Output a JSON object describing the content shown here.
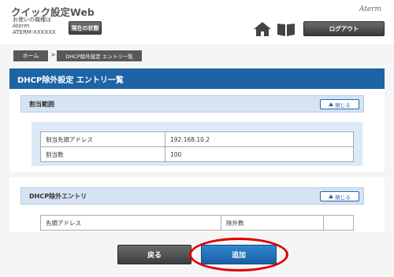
{
  "header": {
    "app_title": "クイック設定Web",
    "model_label": "お使いの機種は",
    "model_name": "Aterm",
    "model_id": "ATERM-XXXXXX",
    "status_button": "現在の状態",
    "brand": "Aterm",
    "logout_button": "ログアウト"
  },
  "breadcrumb": {
    "home": "ホーム",
    "separator": ">",
    "current": "DHCP除外設定 エントリ一覧"
  },
  "page_title": "DHCP除外設定 エントリ一覧",
  "section_assign": {
    "title": "割当範囲",
    "collapse_label": "閉じる",
    "rows": [
      {
        "label": "割当先頭アドレス",
        "value": "192.168.10.2"
      },
      {
        "label": "割当数",
        "value": "100"
      }
    ]
  },
  "section_exclude": {
    "title": "DHCP除外エントリ",
    "collapse_label": "閉じる",
    "headers": [
      "先頭アドレス",
      "除外数",
      ""
    ]
  },
  "footer": {
    "back_button": "戻る",
    "add_button": "追加"
  },
  "colors": {
    "accent_blue": "#1d64a5",
    "highlight_red": "#e00000"
  }
}
